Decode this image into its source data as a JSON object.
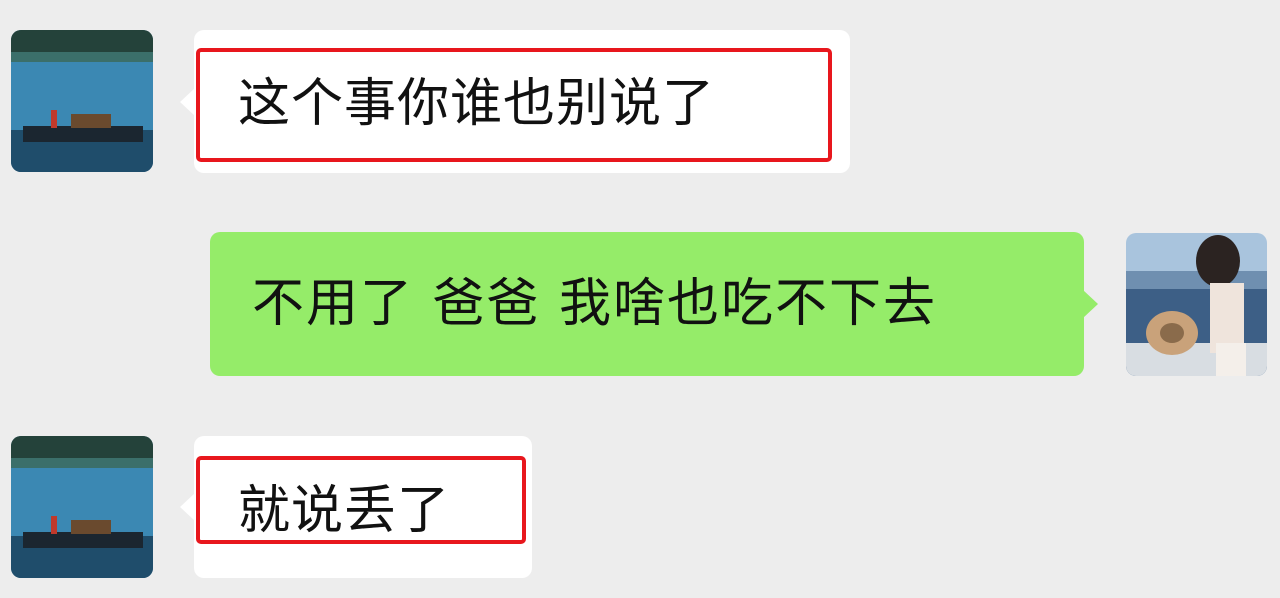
{
  "conversation": {
    "messages": [
      {
        "sender": "left",
        "text": "这个事你谁也别说了",
        "highlighted": true
      },
      {
        "sender": "right",
        "text": "不用了 爸爸 我啥也吃不下去",
        "highlighted": false
      },
      {
        "sender": "left",
        "text": "就说丢了",
        "highlighted": true
      }
    ]
  },
  "colors": {
    "background": "#ededed",
    "incoming_bubble": "#ffffff",
    "outgoing_bubble": "#95ec69",
    "highlight_border": "#e8171d",
    "text": "#111111"
  },
  "icons": {
    "left_avatar": "lake-boat-avatar-image",
    "right_avatar": "woman-on-boat-avatar-image"
  }
}
